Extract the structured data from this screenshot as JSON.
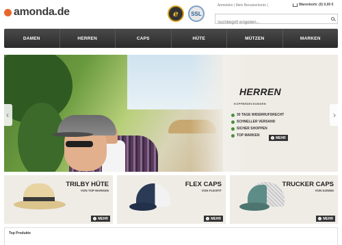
{
  "header": {
    "logo_text": "amonda.de",
    "badge_trusted": "e",
    "badge_ssl": "SSL",
    "top_links": "Anmelden | Mein Benutzerkonto |",
    "cart_label": "Warenkorb: (0) 0,00 €",
    "search_placeholder": "Suchbegriff eingeben..."
  },
  "nav": {
    "items": [
      "DAMEN",
      "HERREN",
      "CAPS",
      "HÜTE",
      "MÜTZEN",
      "MARKEN"
    ]
  },
  "hero": {
    "title": "HERREN",
    "subtitle": "KOPFBEDECKUNGEN",
    "features": [
      "30 TAGE WIDERRUFSRECHT",
      "SCHNELLER VERSAND",
      "SICHER SHOPPEN",
      "TOP MARKEN"
    ],
    "more_label": "MEHR",
    "prev_arrow": "‹",
    "next_arrow": "›"
  },
  "tiles": [
    {
      "title": "TRILBY HÜTE",
      "subtitle": "VON TOP MARKEN",
      "more_label": "MEHR"
    },
    {
      "title": "FLEX CAPS",
      "subtitle": "VON FLEXFIT",
      "more_label": "MEHR"
    },
    {
      "title": "TRUCKER CAPS",
      "subtitle": "VON DJINNS",
      "more_label": "MEHR"
    }
  ],
  "section": {
    "top_products_title": "Top Produkte"
  },
  "colors": {
    "accent_orange": "#e8662a",
    "nav_dark": "#2b2b2b",
    "bullet_green": "#4a8f3c"
  }
}
